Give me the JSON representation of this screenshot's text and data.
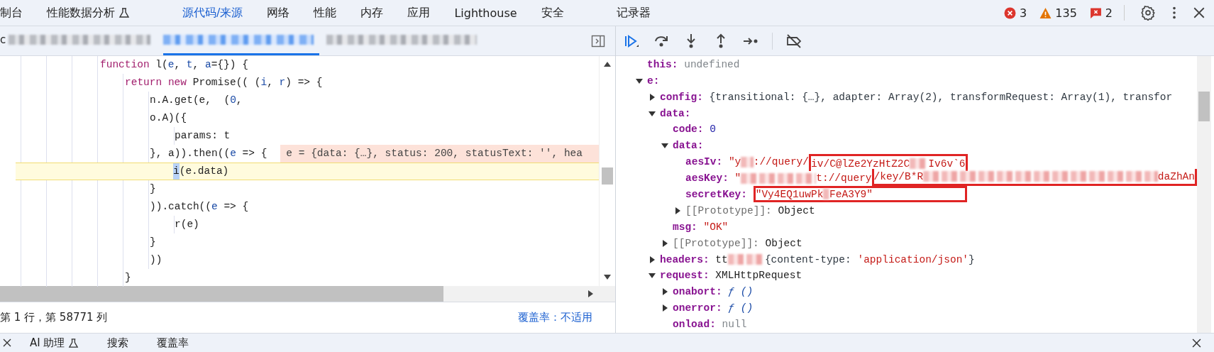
{
  "top_tabs": [
    {
      "label": "制台",
      "selected": false
    },
    {
      "label": "性能数据分析",
      "selected": false,
      "experimental": true
    },
    {
      "label": "源代码/来源",
      "selected": true
    },
    {
      "label": "网络",
      "selected": false
    },
    {
      "label": "性能",
      "selected": false
    },
    {
      "label": "内存",
      "selected": false
    },
    {
      "label": "应用",
      "selected": false
    },
    {
      "label": "Lighthouse",
      "selected": false
    },
    {
      "label": "安全",
      "selected": false
    },
    {
      "label": "记录器",
      "selected": false
    }
  ],
  "counters": [
    {
      "kind": "error",
      "count": "3"
    },
    {
      "kind": "warning",
      "count": "135"
    },
    {
      "kind": "issue",
      "count": "2"
    }
  ],
  "file_tabs": [
    {
      "label": "c",
      "selected": false
    },
    {
      "selected": true
    },
    {
      "selected": false
    }
  ],
  "code_lines": [
    {
      "paused": false,
      "tokens": [
        {
          "text": "function",
          "kind": "keyword"
        },
        {
          "text": " l(",
          "kind": "plain"
        },
        {
          "text": "e",
          "kind": "param"
        },
        {
          "text": ", ",
          "kind": "plain"
        },
        {
          "text": "t",
          "kind": "param"
        },
        {
          "text": ", ",
          "kind": "plain"
        },
        {
          "text": "a",
          "kind": "param"
        },
        {
          "text": "={}) {",
          "kind": "plain"
        }
      ],
      "children": [
        {
          "paused": false,
          "tokens": [
            {
              "text": "return",
              "kind": "keyword"
            },
            {
              "text": " new",
              "kind": "keyword"
            },
            {
              "text": " Promise(( (",
              "kind": "plain"
            },
            {
              "text": "i",
              "kind": "param"
            },
            {
              "text": ", ",
              "kind": "plain"
            },
            {
              "text": "r",
              "kind": "param"
            },
            {
              "text": ") => {",
              "kind": "plain"
            }
          ],
          "children": [
            {
              "paused": false,
              "tokens": [
                {
                  "text": "n.A.get(e,  (",
                  "kind": "plain"
                },
                {
                  "text": "0",
                  "kind": "param"
                },
                {
                  "text": ",",
                  "kind": "plain"
                }
              ]
            },
            {
              "paused": false,
              "tokens": [
                {
                  "text": "o.A)({",
                  "kind": "plain"
                }
              ],
              "children": [
                {
                  "paused": false,
                  "tokens": [
                    {
                      "text": "params: t",
                      "kind": "plain"
                    }
                  ]
                }
              ]
            },
            {
              "paused": false,
              "tokens": [
                {
                  "text": "}, a)).then((",
                  "kind": "plain"
                },
                {
                  "text": "e",
                  "kind": "param"
                },
                {
                  "text": " => {",
                  "kind": "plain"
                }
              ],
              "inline_value": "e = {data: {…}, status: 200, statusText: '', hea",
              "children": [
                {
                  "paused": true,
                  "tokens": [
                    {
                      "text": "i",
                      "kind": "exec"
                    },
                    {
                      "text": "(e.data)",
                      "kind": "plain"
                    }
                  ]
                }
              ]
            },
            {
              "paused": false,
              "tokens": [
                {
                  "text": "}",
                  "kind": "plain"
                }
              ]
            },
            {
              "paused": false,
              "tokens": [
                {
                  "text": ")).catch((",
                  "kind": "plain"
                },
                {
                  "text": "e",
                  "kind": "param"
                },
                {
                  "text": " => {",
                  "kind": "plain"
                }
              ],
              "children": [
                {
                  "paused": false,
                  "tokens": [
                    {
                      "text": "r(e)",
                      "kind": "plain"
                    }
                  ]
                }
              ]
            },
            {
              "paused": false,
              "tokens": [
                {
                  "text": "}",
                  "kind": "plain"
                }
              ]
            },
            {
              "paused": false,
              "tokens": [
                {
                  "text": "))",
                  "kind": "plain"
                }
              ]
            }
          ]
        },
        {
          "paused": false,
          "tokens": [
            {
              "text": "}",
              "kind": "plain"
            }
          ]
        }
      ]
    }
  ],
  "status_bar": {
    "position": "第 1 行，第 58771 列",
    "coverage": "覆盖率：不适用"
  },
  "scope": [
    {
      "key": "this:",
      "value": [
        {
          "text": "undefined",
          "kind": "void"
        }
      ]
    },
    {
      "key": "e:",
      "expanded": true,
      "children": [
        {
          "key": "config:",
          "expanded": false,
          "value": [
            {
              "text": "{transitional: {…}, adapter: Array(2), transformRequest: Array(1), transfor",
              "kind": "object"
            }
          ]
        },
        {
          "key": "data:",
          "expanded": true,
          "children": [
            {
              "key": "code:",
              "value": [
                {
                  "text": "0",
                  "kind": "number"
                }
              ]
            },
            {
              "key": "data:",
              "expanded": true,
              "children": [
                {
                  "key": "aesIv:",
                  "box_joins_next": true,
                  "value": [
                    {
                      "text": "\"y",
                      "kind": "string"
                    },
                    {
                      "kind": "blur"
                    },
                    {
                      "text": "://query/",
                      "kind": "string"
                    },
                    {
                      "text": "iv/C@lZe2YzHtZ2C",
                      "kind": "string",
                      "box_start": true
                    },
                    {
                      "kind": "blur"
                    },
                    {
                      "text": "Iv6v`6",
                      "kind": "string"
                    }
                  ]
                },
                {
                  "key": "aesKey:",
                  "box_joins_previous": true,
                  "value": [
                    {
                      "text": "\"",
                      "kind": "string"
                    },
                    {
                      "kind": "blur"
                    },
                    {
                      "text": "t://query",
                      "kind": "string"
                    },
                    {
                      "text": "/key/B*R",
                      "kind": "string",
                      "box_start": true
                    },
                    {
                      "kind": "blur"
                    },
                    {
                      "text": "daZhAn",
                      "kind": "string"
                    }
                  ]
                },
                {
                  "key": "secretKey:",
                  "value": [
                    {
                      "text": "\"Vy4EQ1uwPk",
                      "kind": "string",
                      "box_start": true
                    },
                    {
                      "kind": "blur"
                    },
                    {
                      "text": "FeA3Y9\"",
                      "kind": "string"
                    }
                  ]
                },
                {
                  "key": "[[Prototype]]:",
                  "internal": true,
                  "expanded": false,
                  "value": [
                    {
                      "text": "Object",
                      "kind": "class"
                    }
                  ]
                }
              ]
            },
            {
              "key": "msg:",
              "value": [
                {
                  "text": "\"OK\"",
                  "kind": "string"
                }
              ]
            },
            {
              "key": "[[Prototype]]:",
              "internal": true,
              "expanded": false,
              "value": [
                {
                  "text": "Object",
                  "kind": "class"
                }
              ]
            }
          ]
        },
        {
          "key": "headers:",
          "expanded": false,
          "value": [
            {
              "text": "tt",
              "kind": "class"
            },
            {
              "kind": "blur"
            },
            {
              "text": "{content-type: ",
              "kind": "object"
            },
            {
              "text": "'application/json'",
              "kind": "string"
            },
            {
              "text": "}",
              "kind": "object"
            }
          ]
        },
        {
          "key": "request:",
          "expanded": true,
          "value": [
            {
              "text": "XMLHttpRequest",
              "kind": "class"
            }
          ],
          "children": [
            {
              "key": "onabort:",
              "expanded": false,
              "value": [
                {
                  "text": "ƒ ()",
                  "kind": "function"
                }
              ]
            },
            {
              "key": "onerror:",
              "expanded": false,
              "value": [
                {
                  "text": "ƒ ()",
                  "kind": "function"
                }
              ]
            },
            {
              "key": "onload:",
              "value": [
                {
                  "text": "null",
                  "kind": "void"
                }
              ]
            }
          ]
        }
      ]
    }
  ],
  "drawer_tabs": [
    {
      "label": "AI 助理",
      "selected": false,
      "experimental": true
    },
    {
      "label": "搜索",
      "selected": false
    },
    {
      "label": "覆盖率",
      "selected": false
    }
  ]
}
